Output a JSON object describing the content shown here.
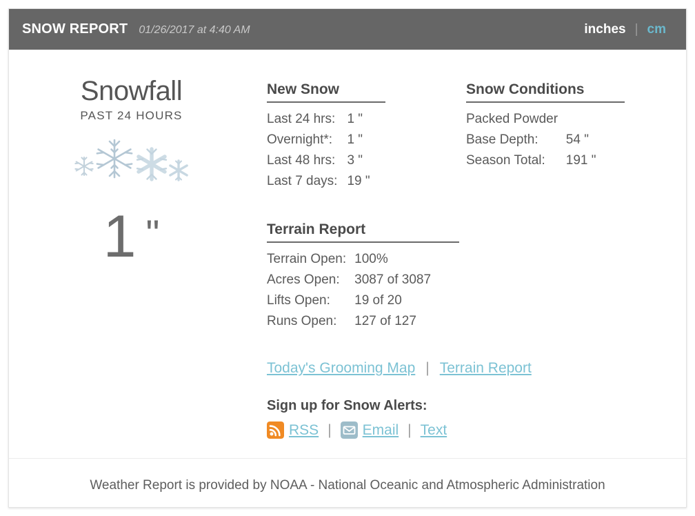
{
  "header": {
    "title": "SNOW REPORT",
    "timestamp": "01/26/2017 at 4:40 AM",
    "units": {
      "active_label": "inches",
      "separator": "|",
      "inactive_label": "cm",
      "active_color": "#ffffff",
      "inactive_color": "#6bb8cc"
    },
    "background_color": "#666666"
  },
  "snowfall": {
    "title": "Snowfall",
    "subtitle": "PAST 24 HOURS",
    "icon": "snowflake-cluster-icon",
    "amount": "1",
    "unit": "\""
  },
  "new_snow": {
    "heading": "New Snow",
    "rows": [
      {
        "label": "Last 24 hrs:",
        "value": "1 \""
      },
      {
        "label": "Overnight*:",
        "value": "1 \""
      },
      {
        "label": "Last 48 hrs:",
        "value": "3 \""
      },
      {
        "label": "Last 7 days:",
        "value": "19 \""
      }
    ]
  },
  "snow_conditions": {
    "heading": "Snow Conditions",
    "condition": "Packed Powder",
    "rows": [
      {
        "label": "Base Depth:",
        "value": "54 \""
      },
      {
        "label": "Season Total:",
        "value": "191 \""
      }
    ]
  },
  "terrain_report": {
    "heading": "Terrain Report",
    "rows": [
      {
        "label": "Terrain Open:",
        "value": "100%"
      },
      {
        "label": "Acres Open:",
        "value": "3087 of 3087"
      },
      {
        "label": "Lifts Open:",
        "value": "19 of 20"
      },
      {
        "label": "Runs Open:",
        "value": "127 of 127"
      }
    ]
  },
  "links": {
    "grooming_map": "Today's Grooming Map",
    "separator": "|",
    "terrain_report": "Terrain Report",
    "color": "#7cc2d4"
  },
  "alerts": {
    "heading": "Sign up for Snow Alerts:",
    "separator": "|",
    "items": [
      {
        "label": "RSS",
        "icon": "rss-icon",
        "icon_color": "#f08a24"
      },
      {
        "label": "Email",
        "icon": "envelope-icon",
        "icon_color": "#9dbcc9"
      },
      {
        "label": "Text",
        "icon": "none",
        "icon_color": ""
      }
    ]
  },
  "footer": {
    "text": "Weather Report is provided by NOAA - National Oceanic and Atmospheric Administration"
  }
}
